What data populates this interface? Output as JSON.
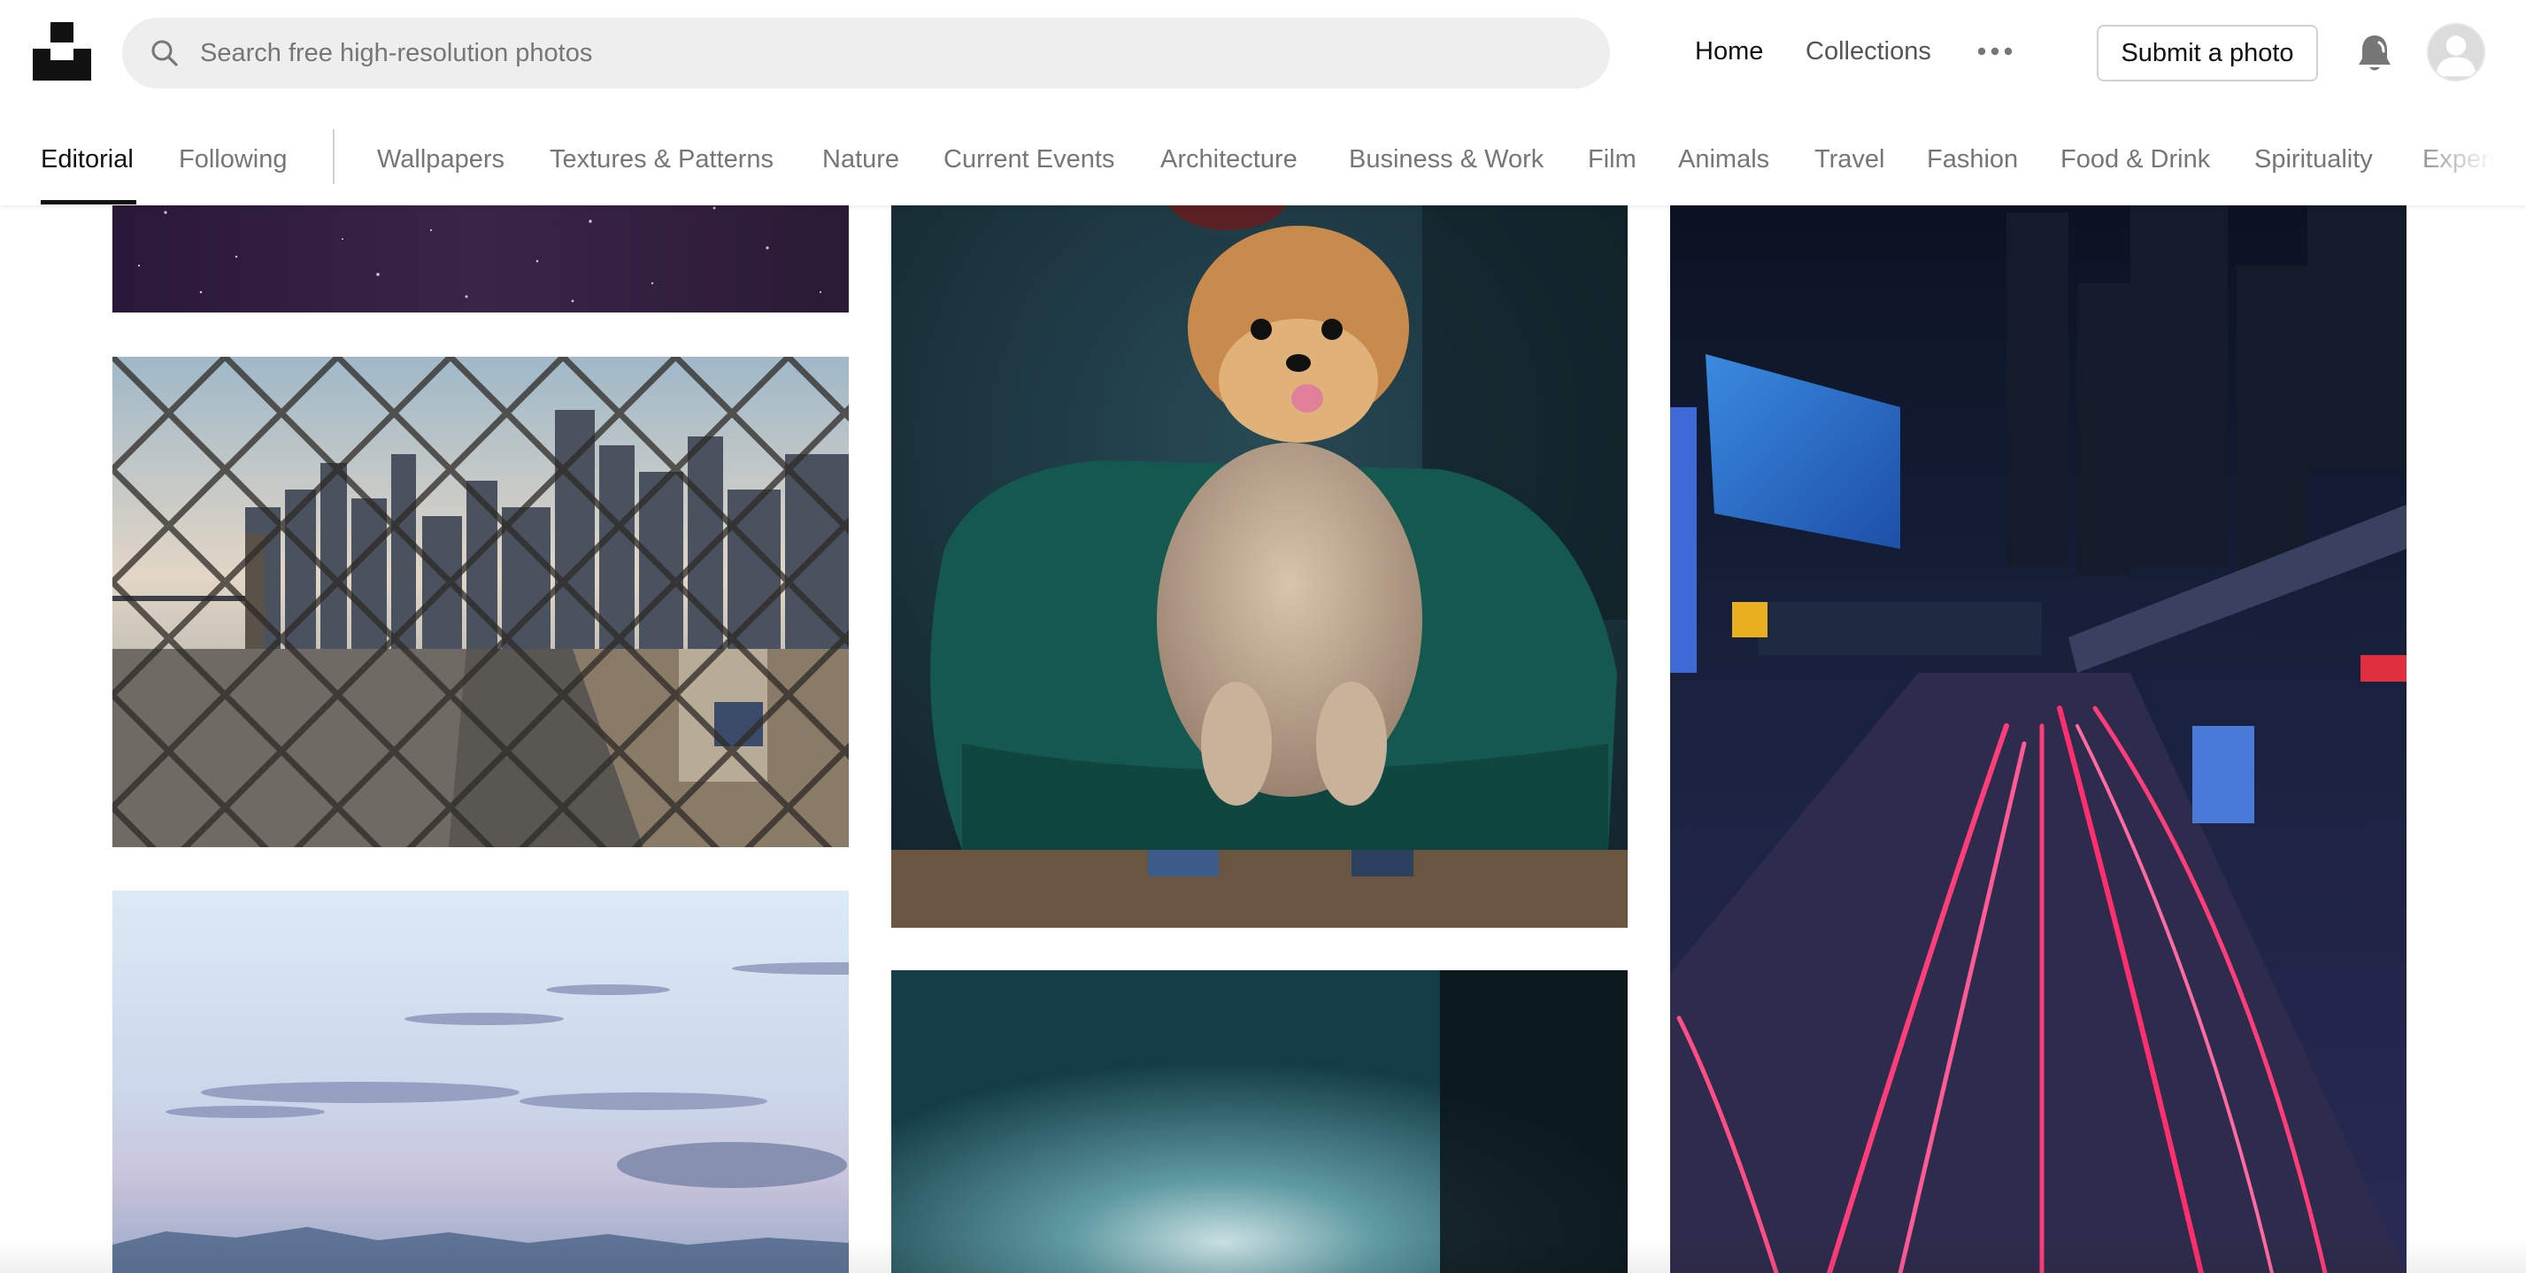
{
  "header": {
    "logo_icon": "unsplash-logo-icon",
    "search": {
      "placeholder": "Search free high-resolution photos",
      "value": ""
    },
    "nav": {
      "home": "Home",
      "collections": "Collections"
    },
    "more_icon": "ellipsis-icon",
    "submit_label": "Submit a photo",
    "notifications_icon": "bell-icon"
  },
  "tabs": {
    "primary": [
      "Editorial",
      "Following"
    ],
    "topics": [
      "Wallpapers",
      "Textures & Patterns",
      "Nature",
      "Current Events",
      "Architecture",
      "Business & Work",
      "Film",
      "Animals",
      "Travel",
      "Fashion",
      "Food & Drink",
      "Spirituality",
      "Experimental"
    ],
    "active": "Editorial"
  },
  "colors": {
    "text": "#111111",
    "muted": "#767676",
    "search_bg": "#eeeeee",
    "border": "#d1d1d1"
  }
}
